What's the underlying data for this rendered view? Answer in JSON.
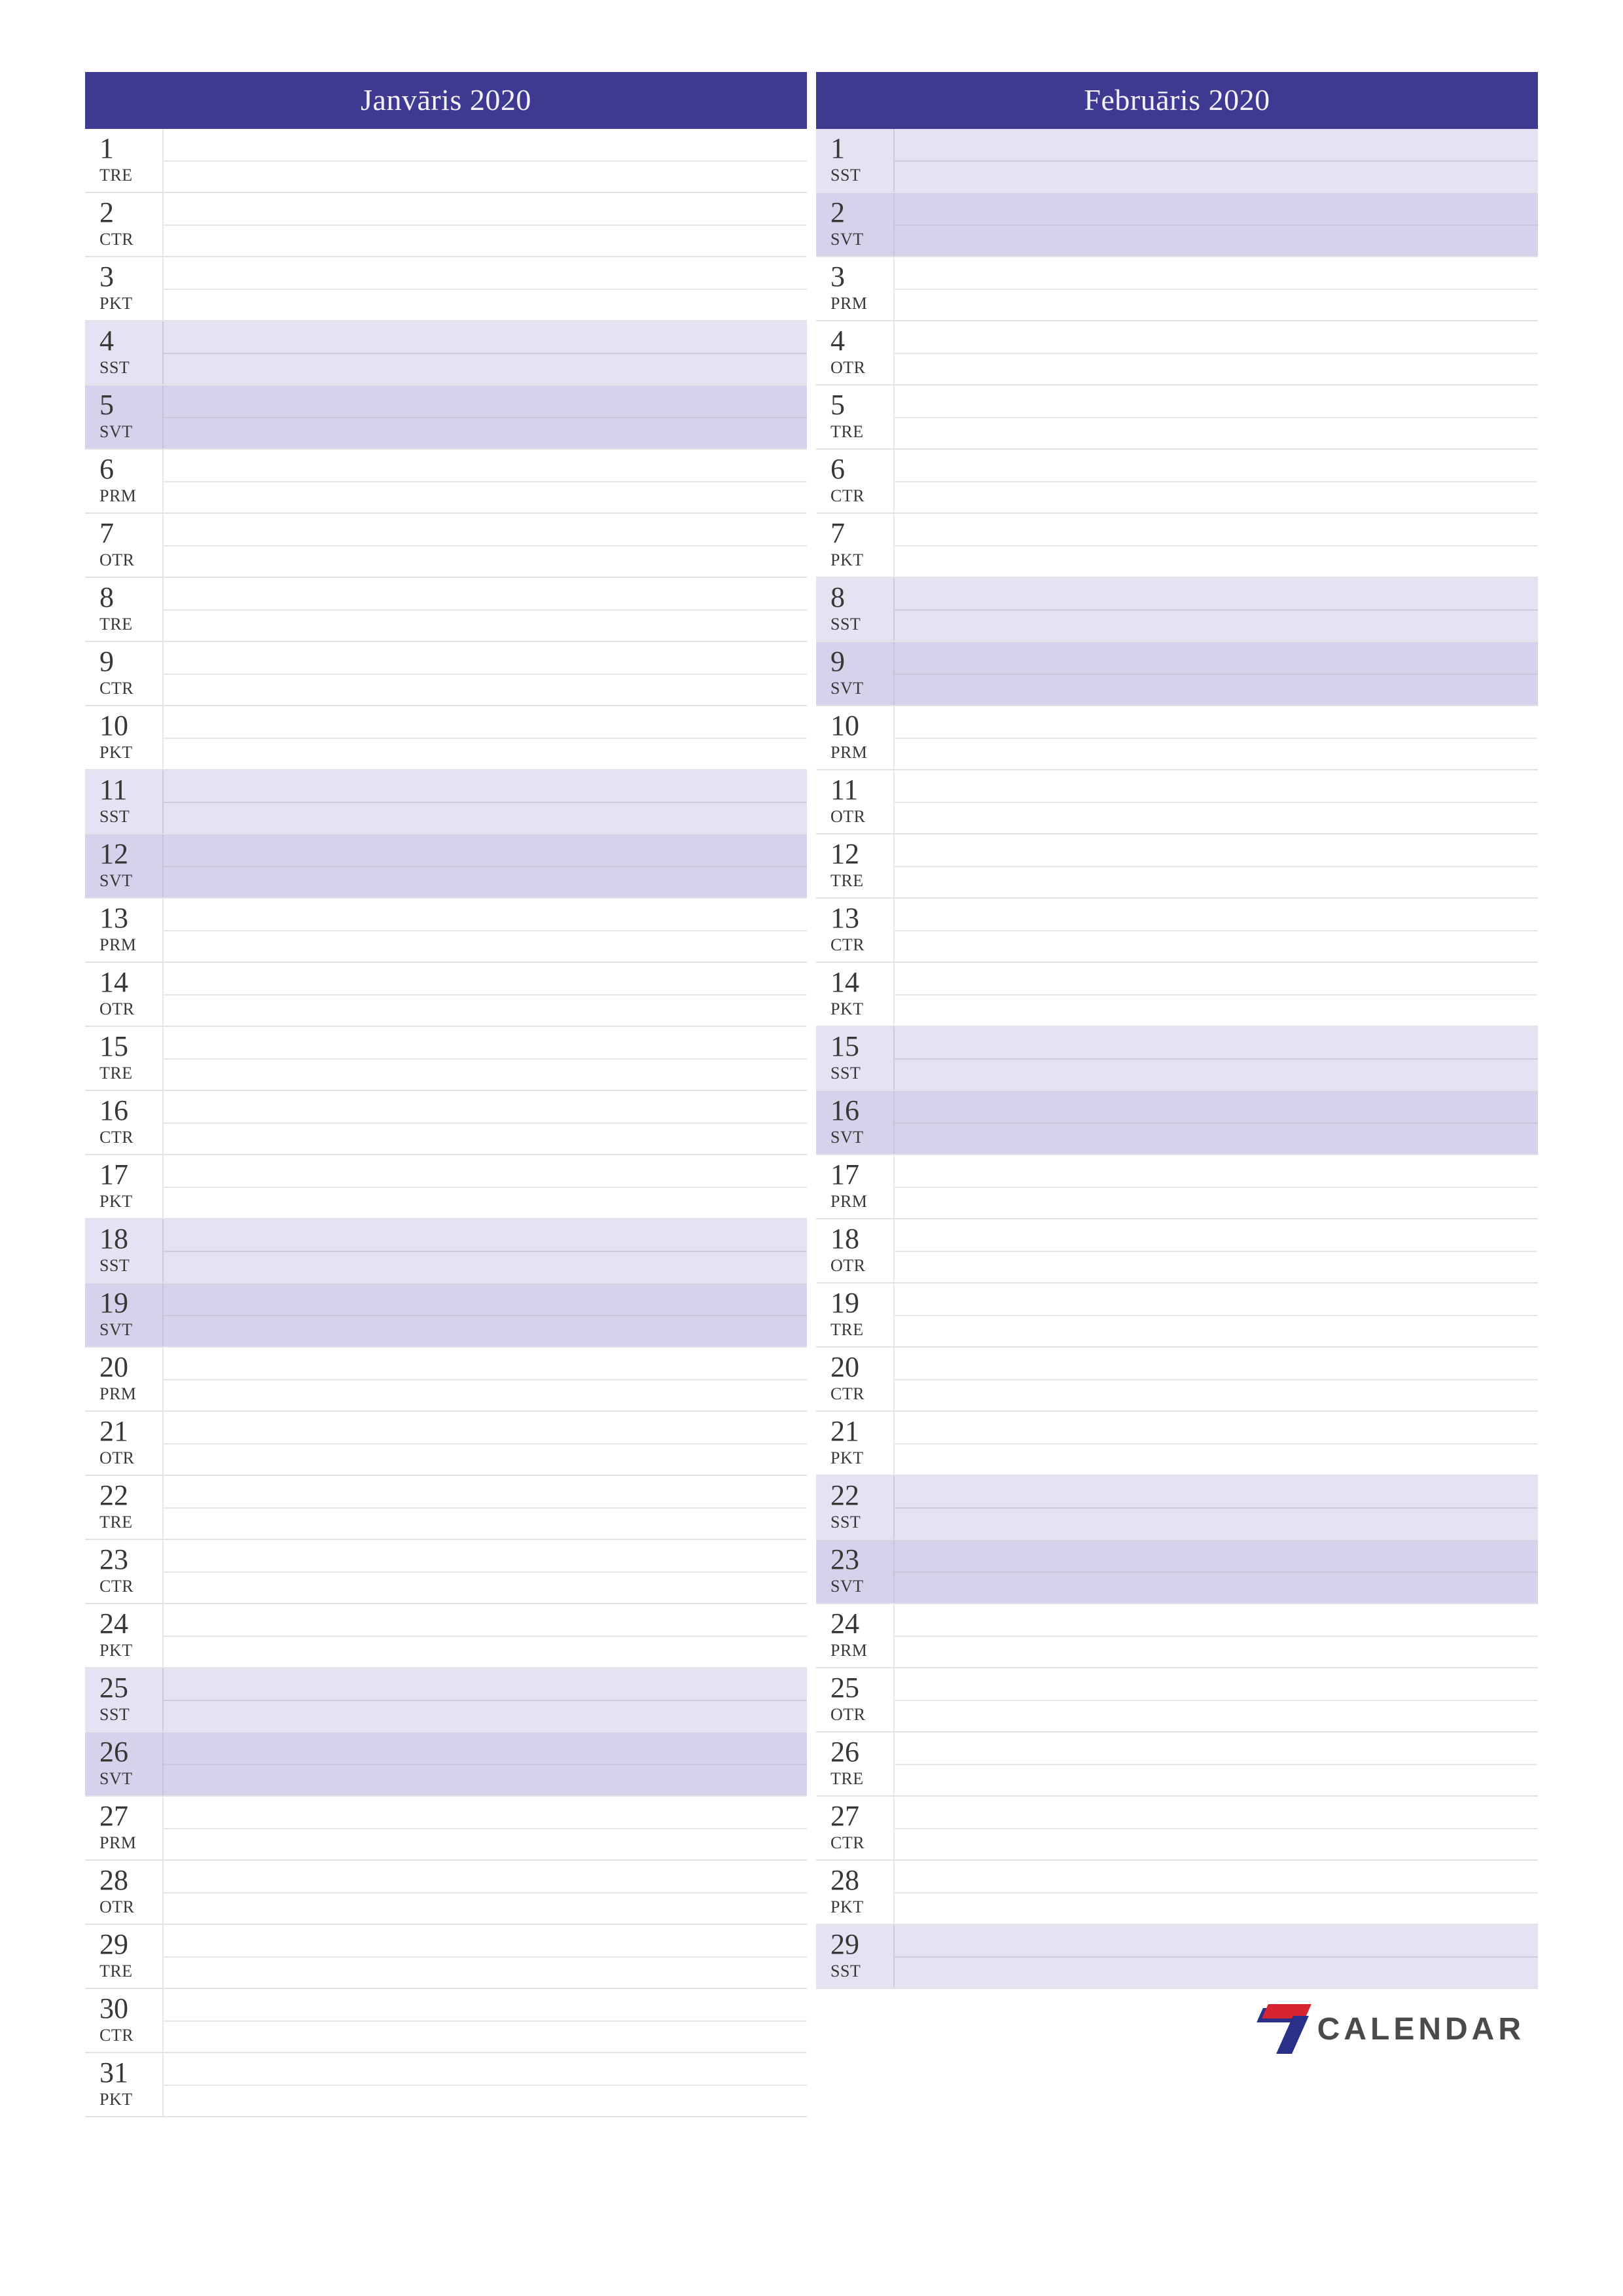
{
  "logo_text": "CALENDAR",
  "months": [
    {
      "title": "Janvāris 2020",
      "days": [
        {
          "n": "1",
          "abbr": "TRE",
          "kind": "wd"
        },
        {
          "n": "2",
          "abbr": "CTR",
          "kind": "wd"
        },
        {
          "n": "3",
          "abbr": "PKT",
          "kind": "wd"
        },
        {
          "n": "4",
          "abbr": "SST",
          "kind": "sat"
        },
        {
          "n": "5",
          "abbr": "SVT",
          "kind": "sun"
        },
        {
          "n": "6",
          "abbr": "PRM",
          "kind": "wd"
        },
        {
          "n": "7",
          "abbr": "OTR",
          "kind": "wd"
        },
        {
          "n": "8",
          "abbr": "TRE",
          "kind": "wd"
        },
        {
          "n": "9",
          "abbr": "CTR",
          "kind": "wd"
        },
        {
          "n": "10",
          "abbr": "PKT",
          "kind": "wd"
        },
        {
          "n": "11",
          "abbr": "SST",
          "kind": "sat"
        },
        {
          "n": "12",
          "abbr": "SVT",
          "kind": "sun"
        },
        {
          "n": "13",
          "abbr": "PRM",
          "kind": "wd"
        },
        {
          "n": "14",
          "abbr": "OTR",
          "kind": "wd"
        },
        {
          "n": "15",
          "abbr": "TRE",
          "kind": "wd"
        },
        {
          "n": "16",
          "abbr": "CTR",
          "kind": "wd"
        },
        {
          "n": "17",
          "abbr": "PKT",
          "kind": "wd"
        },
        {
          "n": "18",
          "abbr": "SST",
          "kind": "sat"
        },
        {
          "n": "19",
          "abbr": "SVT",
          "kind": "sun"
        },
        {
          "n": "20",
          "abbr": "PRM",
          "kind": "wd"
        },
        {
          "n": "21",
          "abbr": "OTR",
          "kind": "wd"
        },
        {
          "n": "22",
          "abbr": "TRE",
          "kind": "wd"
        },
        {
          "n": "23",
          "abbr": "CTR",
          "kind": "wd"
        },
        {
          "n": "24",
          "abbr": "PKT",
          "kind": "wd"
        },
        {
          "n": "25",
          "abbr": "SST",
          "kind": "sat"
        },
        {
          "n": "26",
          "abbr": "SVT",
          "kind": "sun"
        },
        {
          "n": "27",
          "abbr": "PRM",
          "kind": "wd"
        },
        {
          "n": "28",
          "abbr": "OTR",
          "kind": "wd"
        },
        {
          "n": "29",
          "abbr": "TRE",
          "kind": "wd"
        },
        {
          "n": "30",
          "abbr": "CTR",
          "kind": "wd"
        },
        {
          "n": "31",
          "abbr": "PKT",
          "kind": "wd"
        }
      ]
    },
    {
      "title": "Februāris 2020",
      "days": [
        {
          "n": "1",
          "abbr": "SST",
          "kind": "sat"
        },
        {
          "n": "2",
          "abbr": "SVT",
          "kind": "sun"
        },
        {
          "n": "3",
          "abbr": "PRM",
          "kind": "wd"
        },
        {
          "n": "4",
          "abbr": "OTR",
          "kind": "wd"
        },
        {
          "n": "5",
          "abbr": "TRE",
          "kind": "wd"
        },
        {
          "n": "6",
          "abbr": "CTR",
          "kind": "wd"
        },
        {
          "n": "7",
          "abbr": "PKT",
          "kind": "wd"
        },
        {
          "n": "8",
          "abbr": "SST",
          "kind": "sat"
        },
        {
          "n": "9",
          "abbr": "SVT",
          "kind": "sun"
        },
        {
          "n": "10",
          "abbr": "PRM",
          "kind": "wd"
        },
        {
          "n": "11",
          "abbr": "OTR",
          "kind": "wd"
        },
        {
          "n": "12",
          "abbr": "TRE",
          "kind": "wd"
        },
        {
          "n": "13",
          "abbr": "CTR",
          "kind": "wd"
        },
        {
          "n": "14",
          "abbr": "PKT",
          "kind": "wd"
        },
        {
          "n": "15",
          "abbr": "SST",
          "kind": "sat"
        },
        {
          "n": "16",
          "abbr": "SVT",
          "kind": "sun"
        },
        {
          "n": "17",
          "abbr": "PRM",
          "kind": "wd"
        },
        {
          "n": "18",
          "abbr": "OTR",
          "kind": "wd"
        },
        {
          "n": "19",
          "abbr": "TRE",
          "kind": "wd"
        },
        {
          "n": "20",
          "abbr": "CTR",
          "kind": "wd"
        },
        {
          "n": "21",
          "abbr": "PKT",
          "kind": "wd"
        },
        {
          "n": "22",
          "abbr": "SST",
          "kind": "sat"
        },
        {
          "n": "23",
          "abbr": "SVT",
          "kind": "sun"
        },
        {
          "n": "24",
          "abbr": "PRM",
          "kind": "wd"
        },
        {
          "n": "25",
          "abbr": "OTR",
          "kind": "wd"
        },
        {
          "n": "26",
          "abbr": "TRE",
          "kind": "wd"
        },
        {
          "n": "27",
          "abbr": "CTR",
          "kind": "wd"
        },
        {
          "n": "28",
          "abbr": "PKT",
          "kind": "wd"
        },
        {
          "n": "29",
          "abbr": "SST",
          "kind": "sat"
        }
      ]
    }
  ]
}
